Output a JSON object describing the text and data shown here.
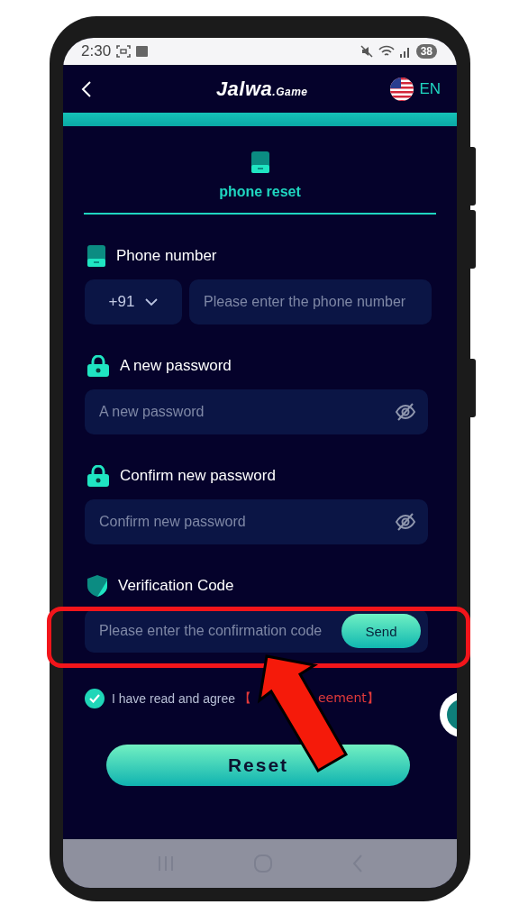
{
  "status_bar": {
    "time": "2:30",
    "battery": "38"
  },
  "header": {
    "logo": "Jalwa",
    "logo_suffix": ".Game",
    "language": "EN"
  },
  "tab": {
    "label": "phone reset",
    "selected": true
  },
  "fields": [
    {
      "kind": "phone",
      "label": "Phone number",
      "country_code": "+91",
      "placeholder": "Please enter the phone number"
    },
    {
      "kind": "password",
      "label": "A new password",
      "placeholder": "A new password"
    },
    {
      "kind": "password",
      "label": "Confirm new password",
      "placeholder": "Confirm new password"
    },
    {
      "kind": "code",
      "label": "Verification Code",
      "placeholder": "Please enter the confirmation code",
      "button": "Send"
    }
  ],
  "agreement": {
    "checked": true,
    "text": "I have read and agree",
    "link_start": "【",
    "link_end": "eement】"
  },
  "reset_button": "Reset"
}
